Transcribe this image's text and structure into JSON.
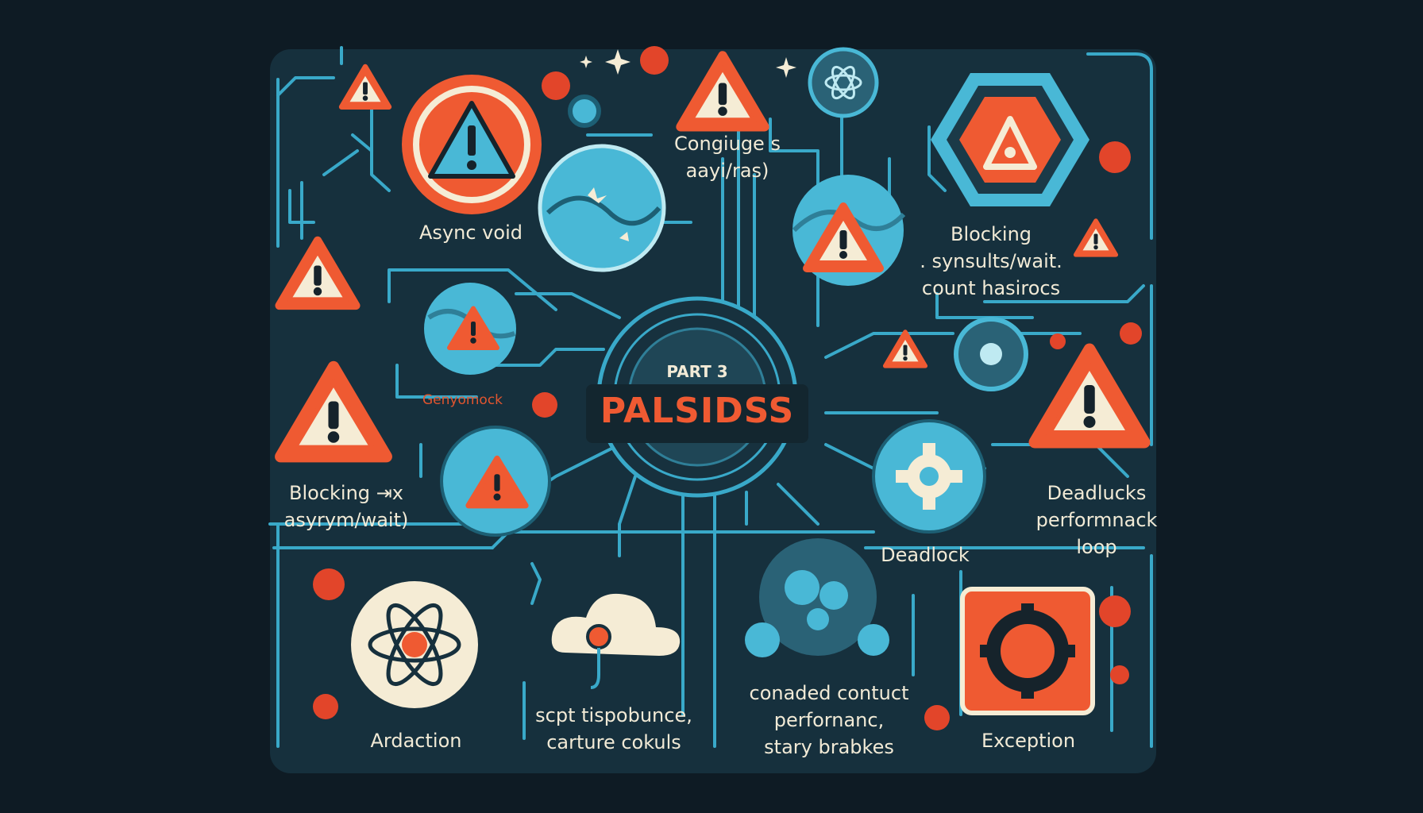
{
  "center": {
    "part": "PART 3",
    "title": "PALSIDSS"
  },
  "labels": {
    "async_void": "Async void",
    "congiuge": [
      "Congiuge s",
      "aayi/ras)"
    ],
    "blocking_top": [
      "Blocking",
      ". synsults/wait.",
      "count hasirocs"
    ],
    "genyomock": "Genyomock",
    "blocking_left": [
      "Blocking ⇥x",
      "asyrym/wait)"
    ],
    "deadlucks": [
      "Deadlucks",
      "performnack",
      "loop"
    ],
    "deadlock": "Deadlock",
    "ardaction": "Ardaction",
    "scpt": [
      "scpt tispobunce,",
      "carture cokuls"
    ],
    "conaded": [
      "conaded contuct",
      "perfornanc,",
      "stary brabkes"
    ],
    "exception": "Exception"
  },
  "icons": [
    "warning-triangle-icon",
    "atom-icon",
    "gear-icon",
    "cloud-icon",
    "hexagon-warning-icon",
    "orb-icon"
  ],
  "colors": {
    "background": "#0e1b24",
    "panel": "#16303d",
    "circuit": "#39a9c9",
    "accent": "#ef5a32",
    "cream": "#f5ecd5",
    "cyan": "#49b8d6"
  }
}
